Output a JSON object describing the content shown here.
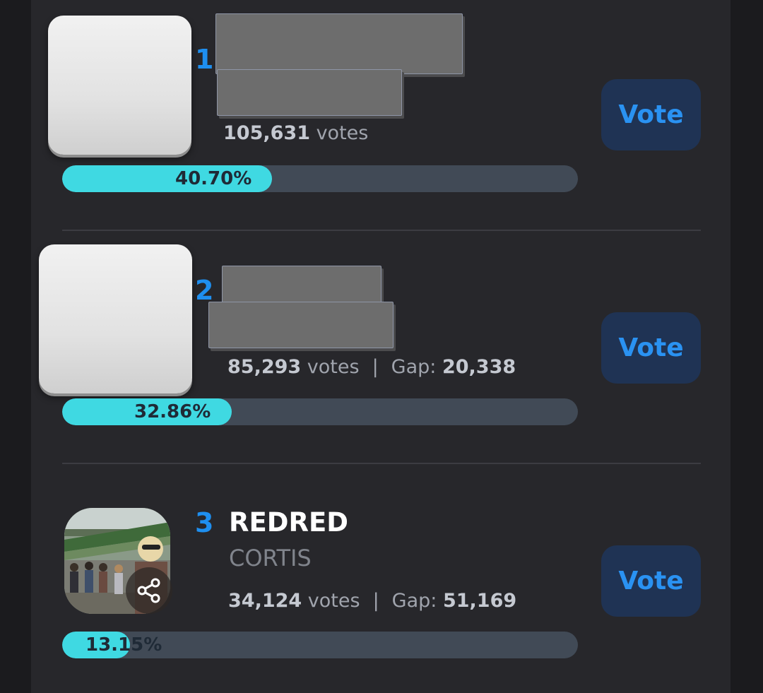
{
  "entries": [
    {
      "rank": "1",
      "votes": "105,631",
      "votes_suffix": " votes",
      "percent": "40.70%",
      "fill": 0.407,
      "vote_label": "Vote"
    },
    {
      "rank": "2",
      "votes": "85,293",
      "votes_suffix": " votes",
      "gap_label": "Gap: ",
      "gap": "20,338",
      "separator": "|",
      "percent": "32.86%",
      "fill": 0.3286,
      "vote_label": "Vote"
    },
    {
      "rank": "3",
      "title": "REDRED",
      "artist": "CORTIS",
      "votes": "34,124",
      "votes_suffix": " votes",
      "gap_label": "Gap: ",
      "gap": "51,169",
      "separator": "|",
      "percent": "13.15%",
      "fill": 0.1315,
      "vote_label": "Vote"
    }
  ],
  "colors": {
    "accent": "#1e8ff0",
    "bar_fill": "#3fd9e2",
    "bar_track": "#414a56",
    "button_bg": "#1f3354"
  },
  "icons": {
    "share": "share-icon"
  }
}
